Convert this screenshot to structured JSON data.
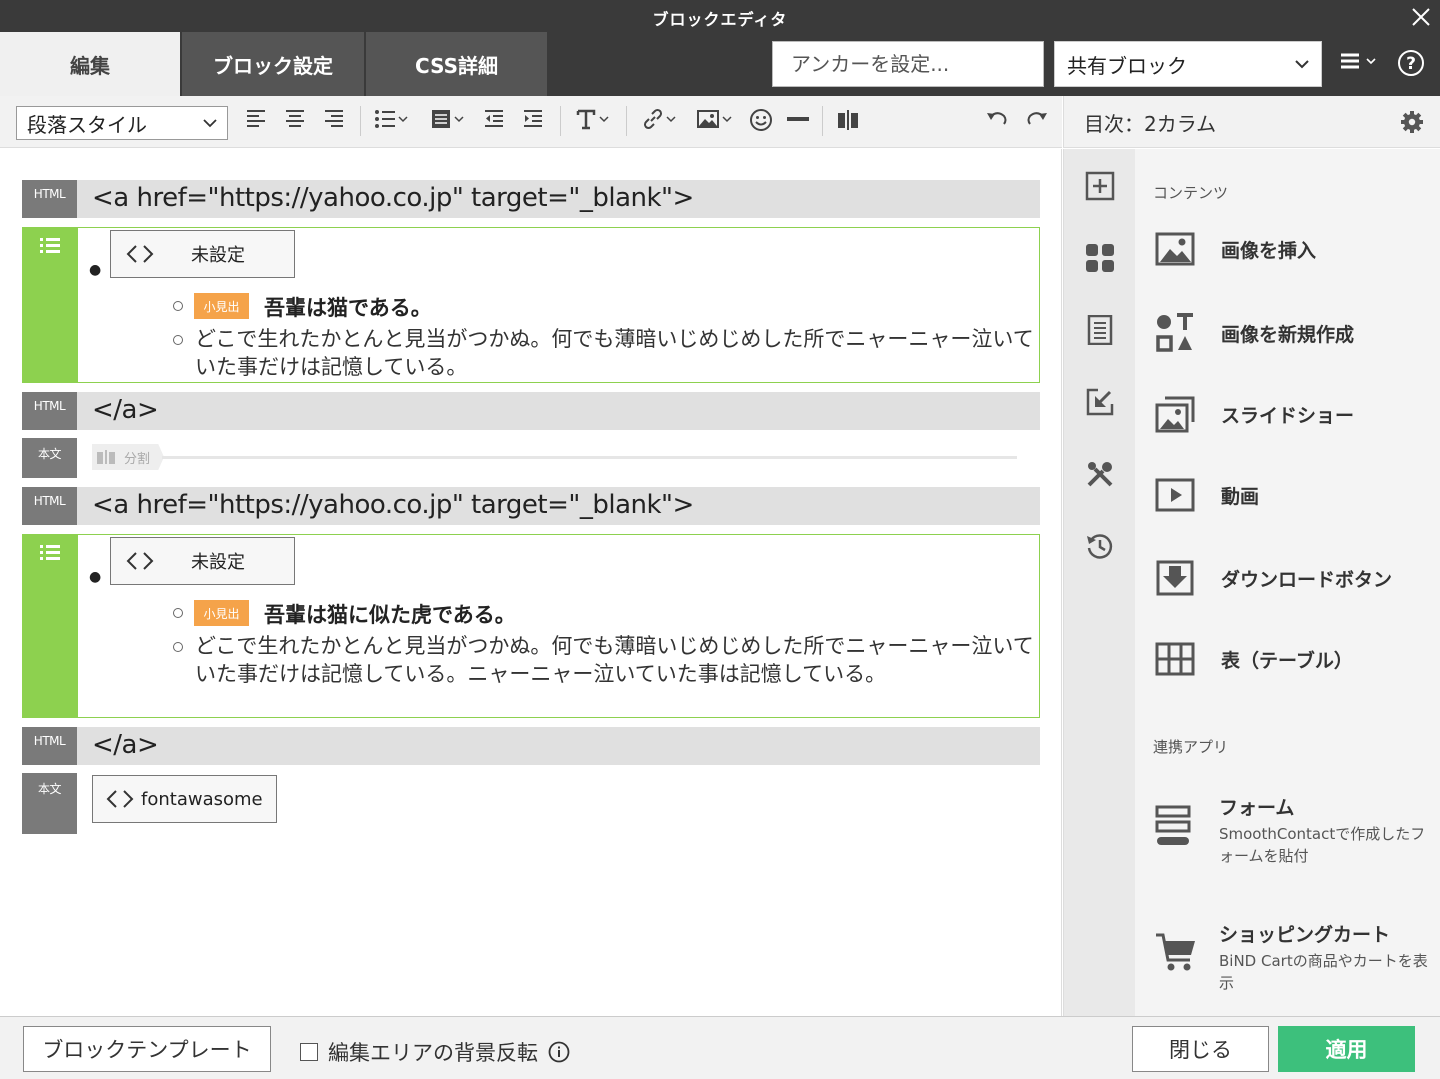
{
  "window": {
    "title": "ブロックエディタ"
  },
  "tabs": [
    {
      "label": "編集"
    },
    {
      "label": "ブロック設定"
    },
    {
      "label": "CSS詳細"
    }
  ],
  "anchor": {
    "placeholder": "アンカーを設定..."
  },
  "shared_block": {
    "value": "共有ブロック"
  },
  "toolbar": {
    "paragraph_style": "段落スタイル"
  },
  "sidebar_header": {
    "label": "目次：2カラム"
  },
  "blocks": {
    "html1": {
      "tag": "HTML",
      "code": "<a href=\"https://yahoo.co.jp\" target=\"_blank\">"
    },
    "list1": {
      "unset": "未設定",
      "badge": "小見出",
      "heading": "吾輩は猫である。",
      "text": "どこで生れたかとんと見当がつかぬ。何でも薄暗いじめじめした所でニャーニャー泣いていた事だけは記憶している。"
    },
    "html2": {
      "tag": "HTML",
      "code": "</a>"
    },
    "body1": {
      "tag": "本文",
      "split": "分割"
    },
    "html3": {
      "tag": "HTML",
      "code": "<a href=\"https://yahoo.co.jp\" target=\"_blank\">"
    },
    "list2": {
      "unset": "未設定",
      "badge": "小見出",
      "heading": "吾輩は猫に似た虎である。",
      "text": "どこで生れたかとんと見当がつかぬ。何でも薄暗いじめじめした所でニャーニャー泣いていた事だけは記憶している。ニャーニャー泣いていた事は記憶している。"
    },
    "html4": {
      "tag": "HTML",
      "code": "</a>"
    },
    "body2": {
      "tag": "本文",
      "button": "fontawasome"
    }
  },
  "panel": {
    "contents_title": "コンテンツ",
    "items": [
      {
        "label": "画像を挿入",
        "icon": "image-icon"
      },
      {
        "label": "画像を新規作成",
        "icon": "shapes-icon"
      },
      {
        "label": "スライドショー",
        "icon": "slideshow-icon"
      },
      {
        "label": "動画",
        "icon": "video-icon"
      },
      {
        "label": "ダウンロードボタン",
        "icon": "download-icon"
      },
      {
        "label": "表（テーブル）",
        "icon": "table-icon"
      }
    ],
    "apps_title": "連携アプリ",
    "apps": [
      {
        "label": "フォーム",
        "desc": "SmoothContactで作成したフォームを貼付",
        "icon": "form-icon"
      },
      {
        "label": "ショッピングカート",
        "desc": "BiND Cartの商品やカートを表示",
        "icon": "cart-icon"
      }
    ]
  },
  "footer": {
    "template_button": "ブロックテンプレート",
    "invert_label": "編集エリアの背景反転",
    "close_button": "閉じる",
    "apply_button": "適用"
  },
  "colors": {
    "accent_green": "#8dd14f",
    "apply_green": "#3dc07c",
    "badge_orange": "#f5a34a",
    "dark_bar": "#3a3a3a"
  }
}
